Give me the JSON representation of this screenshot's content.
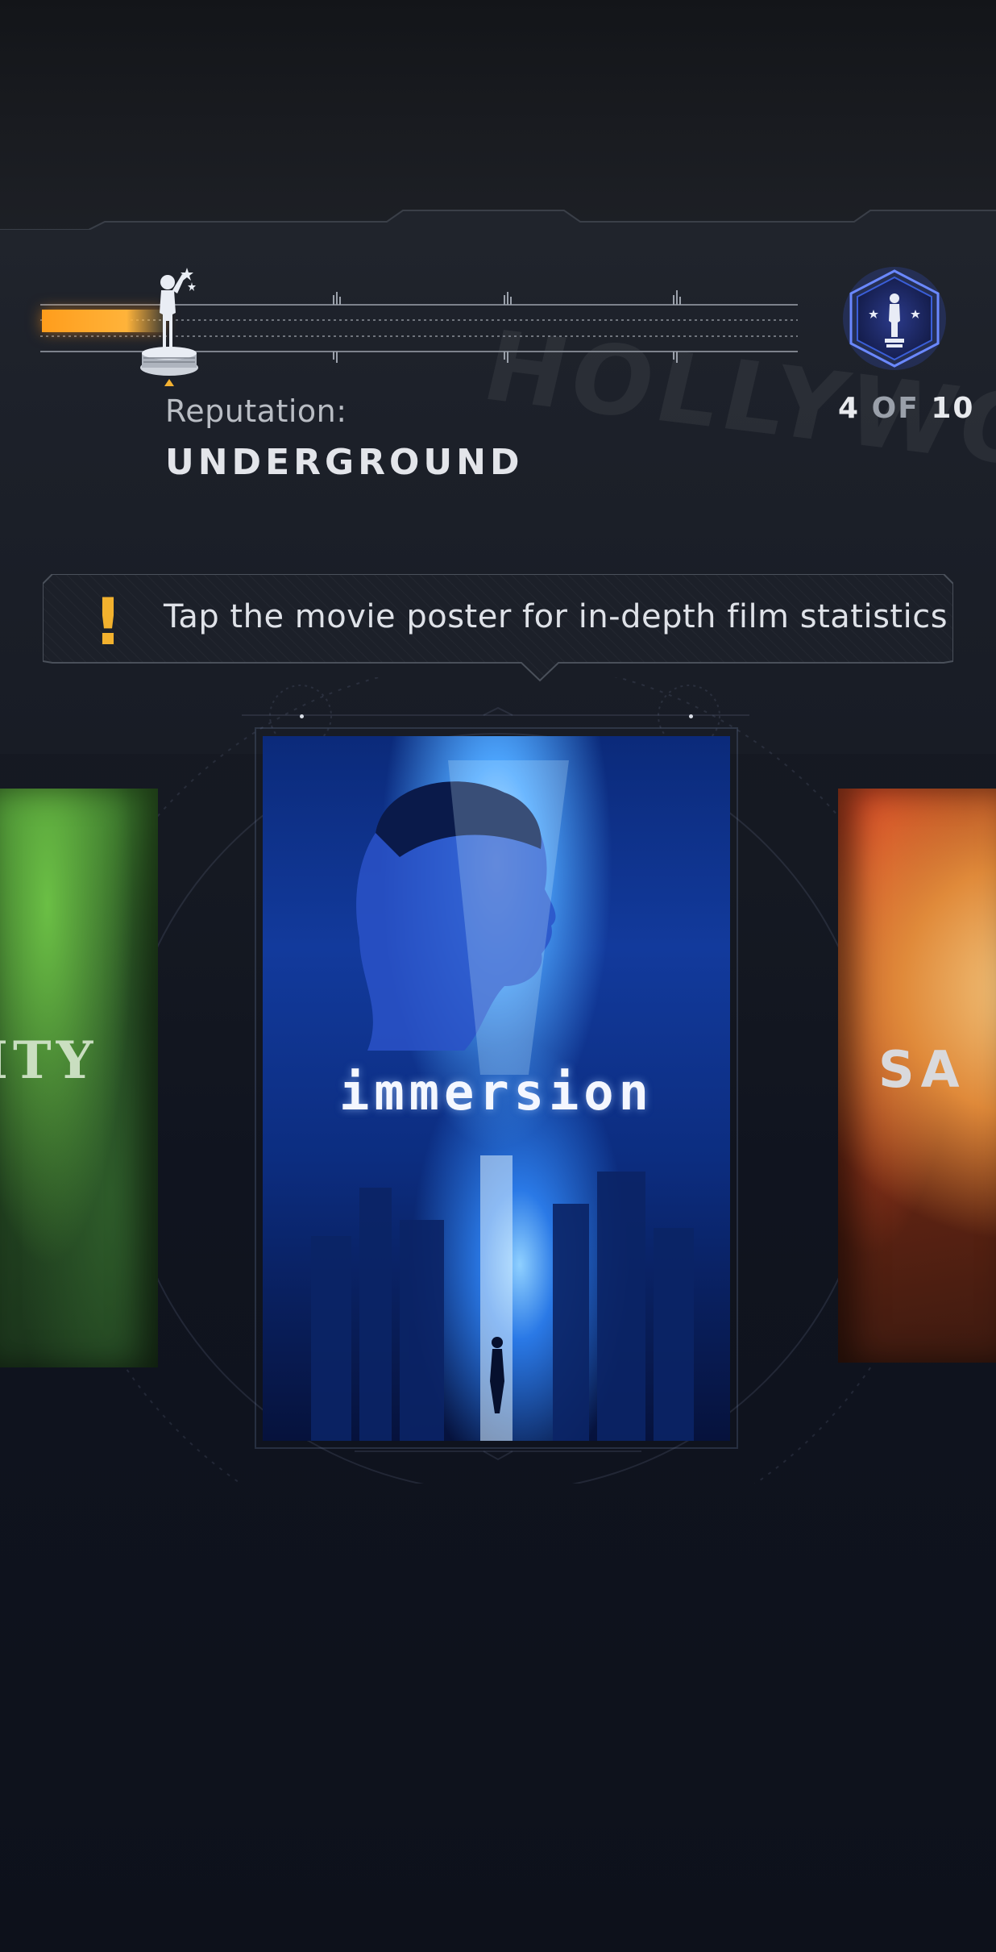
{
  "reputation": {
    "label": "Reputation:",
    "value": "UNDERGROUND",
    "progress_fraction": 0.16
  },
  "rank": {
    "current": "4",
    "separator": "OF",
    "total": "10"
  },
  "tip": {
    "text": "Tap the movie poster for in-depth film statistics",
    "bang": "!"
  },
  "posters": {
    "left_title": "ITY",
    "center_title": "immersion",
    "right_title": "SA"
  },
  "colors": {
    "accent_orange": "#ffa326",
    "badge_blue": "#3a5ed8",
    "text_light": "#e3e5ea"
  },
  "icons": {
    "progress_marker": "oscar-statue-icon",
    "rank_badge": "oscar-badge-icon",
    "tip_marker": "exclamation-icon"
  }
}
